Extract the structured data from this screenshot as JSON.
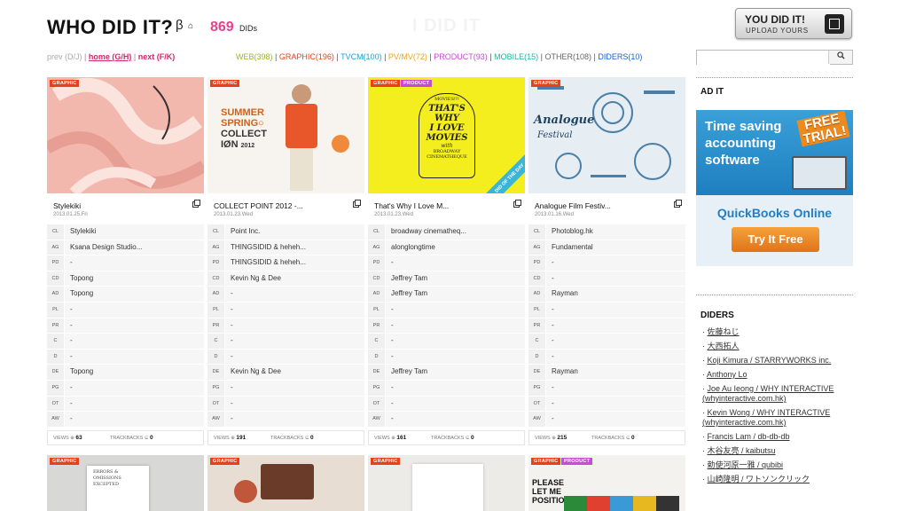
{
  "header": {
    "logo": "WHO DID IT?",
    "beta": "β",
    "home_icon": "⌂",
    "did_count": "869",
    "did_count_label": "DIDs",
    "ghost_text": "I DID IT",
    "upload_line1": "YOU DID IT!",
    "upload_line2": "UPLOAD YOURS"
  },
  "nav": {
    "prev": "prev (D/J)",
    "home": "home (G/H)",
    "next": "next (F/K)",
    "sep": "|"
  },
  "categories": [
    {
      "label": "WEB(398)",
      "color": "#9ab81a"
    },
    {
      "label": "GRAPHIC(196)",
      "color": "#e8411a"
    },
    {
      "label": "TVCM(100)",
      "color": "#1aa3d8"
    },
    {
      "label": "PV/MV(72)",
      "color": "#f0a21a"
    },
    {
      "label": "PRODUCT(93)",
      "color": "#c84bd3"
    },
    {
      "label": "MOBILE(15)",
      "color": "#23b3a0"
    },
    {
      "label": "OTHER(108)",
      "color": "#666666"
    },
    {
      "label": "DIDERS(10)",
      "color": "#1a5fd8"
    }
  ],
  "search": {
    "placeholder": "",
    "button_icon": "search-icon"
  },
  "field_keys": [
    "CL",
    "AG",
    "PD",
    "CD",
    "AD",
    "PL",
    "PR",
    "C",
    "D",
    "DE",
    "PG",
    "OT",
    "AW"
  ],
  "stats_labels": {
    "views": "VIEWS ⊕",
    "trackbacks": "TRACKBACKS ⊆"
  },
  "cards": [
    {
      "tags": [
        {
          "label": "GRAPHIC",
          "type": "g"
        }
      ],
      "title": "Stylekiki",
      "date": "2013.01.25.Fri",
      "fields": [
        "Stylekiki",
        "Ksana Design Studio...",
        "-",
        "Topong",
        "Topong",
        "-",
        "-",
        "-",
        "-",
        "Topong",
        "-",
        "-",
        "-"
      ],
      "views": "63",
      "trackbacks": "0"
    },
    {
      "tags": [
        {
          "label": "GRAPHIC",
          "type": "g"
        }
      ],
      "title": "COLLECT POINT 2012 -...",
      "date": "2013.01.23.Wed",
      "fields": [
        "Point Inc.",
        "THINGSIDID & heheh...",
        "THINGSIDID & heheh...",
        "Kevin Ng & Dee",
        "-",
        "-",
        "-",
        "-",
        "-",
        "Kevin Ng & Dee",
        "-",
        "-",
        "-"
      ],
      "views": "191",
      "trackbacks": "0"
    },
    {
      "tags": [
        {
          "label": "GRAPHIC",
          "type": "g"
        },
        {
          "label": "PRODUCT",
          "type": "p"
        }
      ],
      "title": "That's Why I Love M...",
      "date": "2013.01.23.Wed",
      "fields": [
        "broadway cinematheq...",
        "alonglongtime",
        "-",
        "Jeffrey Tam",
        "Jeffrey Tam",
        "-",
        "-",
        "-",
        "-",
        "Jeffrey Tam",
        "-",
        "-",
        "-"
      ],
      "views": "161",
      "trackbacks": "0"
    },
    {
      "tags": [
        {
          "label": "GRAPHIC",
          "type": "g"
        }
      ],
      "title": "Analogue Film Festiv...",
      "date": "2013.01.16.Wed",
      "fields": [
        "Photoblog.hk",
        "Fundamental",
        "-",
        "-",
        "Rayman",
        "-",
        "-",
        "-",
        "-",
        "Rayman",
        "-",
        "-",
        "-"
      ],
      "views": "215",
      "trackbacks": "0"
    }
  ],
  "thumb_text": {
    "summer": "SUMMER",
    "spring": "SPRING○",
    "collect": "COLLECT",
    "ion": "IØN",
    "year": "2012",
    "movies_top": "MOVIES!!!",
    "movies_lines": [
      "THAT'S",
      "WHY",
      "I LOVE",
      "MOVIES"
    ],
    "with": "with",
    "bc1": "BROADWAY",
    "bc2": "CINEMATHEQUE",
    "did_day": "DID OF THE DAY",
    "analogue1": "Analogue",
    "analogue2": "Festival"
  },
  "row2": [
    {
      "tags": [
        {
          "label": "GRAPHIC",
          "type": "g"
        }
      ],
      "text": "ERRORS & OMISSIONS EXCEPTED"
    },
    {
      "tags": [
        {
          "label": "GRAPHIC",
          "type": "g"
        }
      ],
      "text": ""
    },
    {
      "tags": [
        {
          "label": "GRAPHIC",
          "type": "g"
        }
      ],
      "text": ""
    },
    {
      "tags": [
        {
          "label": "GRAPHIC",
          "type": "g"
        },
        {
          "label": "PRODUCT",
          "type": "p"
        }
      ],
      "text": "PLEASE LET ME POSITION"
    }
  ],
  "sidebar": {
    "ad_heading": "AD IT",
    "ad": {
      "line1": "Time saving",
      "line2": "accounting",
      "line3": "software",
      "badge1": "FREE",
      "badge2": "TRIAL!",
      "product": "QuickBooks Online",
      "cta": "Try It Free"
    },
    "diders_heading": "DIDERS",
    "diders": [
      "佐藤ねじ",
      "大西拓人",
      "Koji Kimura / STARRYWORKS inc.",
      "Anthony Lo",
      "Joe Au Ieong / WHY INTERACTIVE (whyinteractive.com.hk)",
      "Kevin Wong / WHY INTERACTIVE (whyinteractive.com.hk)",
      "Francis Lam / db-db-db",
      "木谷友亮 / kaibutsu",
      "勅使河原一雅 / qubibi",
      "山崎隆明 / ワトソンクリック"
    ]
  }
}
